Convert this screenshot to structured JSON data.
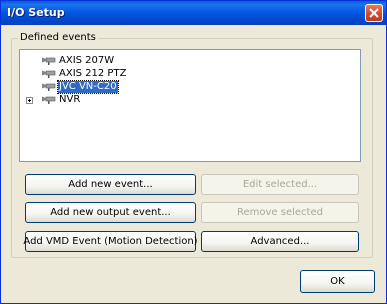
{
  "window": {
    "title": "I/O Setup"
  },
  "group": {
    "label": "Defined events"
  },
  "tree": {
    "items": [
      {
        "label": "AXIS 207W",
        "selected": false,
        "expandable": false,
        "icon": "camera-icon"
      },
      {
        "label": "AXIS 212 PTZ",
        "selected": false,
        "expandable": false,
        "icon": "camera-icon"
      },
      {
        "label": "JVC VN-C20",
        "selected": true,
        "expandable": false,
        "icon": "camera-icon"
      },
      {
        "label": "NVR",
        "selected": false,
        "expandable": true,
        "icon": "camera-icon"
      }
    ]
  },
  "buttons": {
    "add_new_event": "Add new event...",
    "edit_selected": "Edit selected...",
    "add_new_output_event": "Add new output event...",
    "remove_selected": "Remove selected",
    "add_vmd_event": "Add VMD Event (Motion Detection)",
    "advanced": "Advanced...",
    "ok": "OK"
  },
  "colors": {
    "titlebar": "#0054e3",
    "selection": "#316ac5",
    "close_button": "#d2452b"
  }
}
